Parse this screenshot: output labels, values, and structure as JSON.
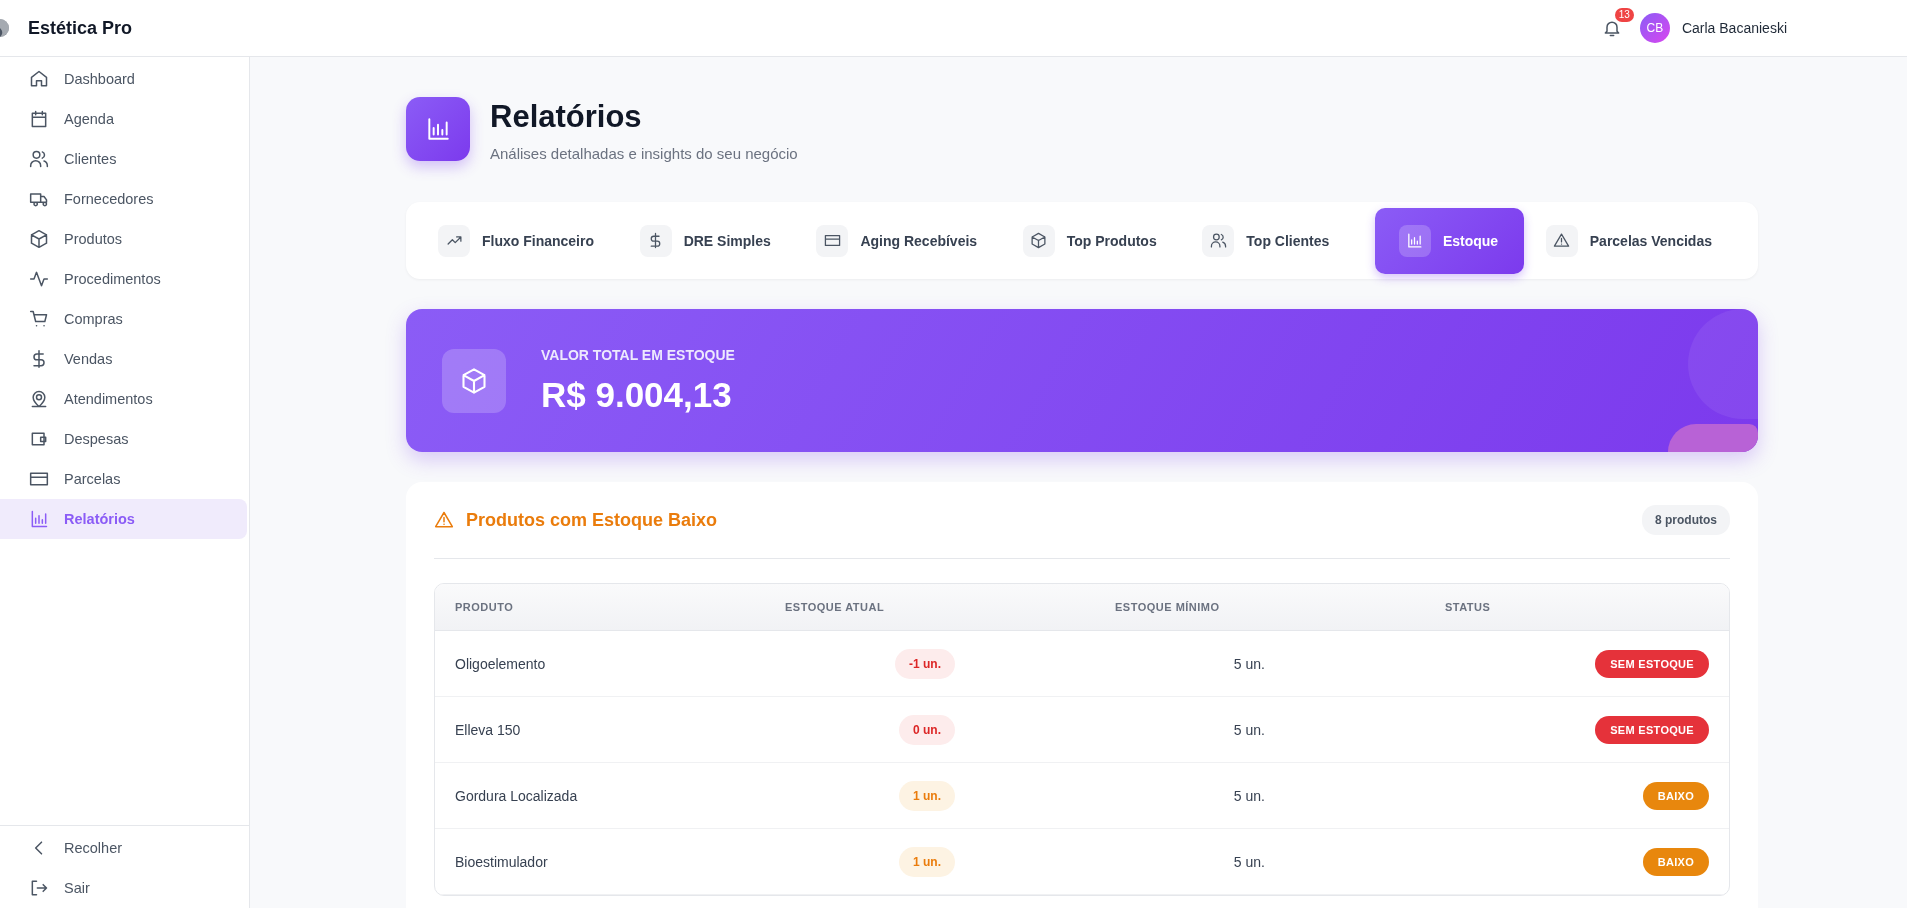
{
  "app": {
    "title": "Estética Pro"
  },
  "header": {
    "notification_count": "13",
    "user": {
      "initials": "CB",
      "name": "Carla Bacanieski"
    }
  },
  "sidebar": {
    "items": [
      {
        "label": "Dashboard",
        "selected": false
      },
      {
        "label": "Agenda",
        "selected": false
      },
      {
        "label": "Clientes",
        "selected": false
      },
      {
        "label": "Fornecedores",
        "selected": false
      },
      {
        "label": "Produtos",
        "selected": false
      },
      {
        "label": "Procedimentos",
        "selected": false
      },
      {
        "label": "Compras",
        "selected": false
      },
      {
        "label": "Vendas",
        "selected": false
      },
      {
        "label": "Atendimentos",
        "selected": false
      },
      {
        "label": "Despesas",
        "selected": false
      },
      {
        "label": "Parcelas",
        "selected": false
      },
      {
        "label": "Relatórios",
        "selected": true
      }
    ],
    "footer": [
      {
        "label": "Recolher"
      },
      {
        "label": "Sair"
      }
    ]
  },
  "page": {
    "title": "Relatórios",
    "subtitle": "Análises detalhadas e insights do seu negócio"
  },
  "tabs": [
    {
      "label": "Fluxo Financeiro",
      "selected": false
    },
    {
      "label": "DRE Simples",
      "selected": false
    },
    {
      "label": "Aging Recebíveis",
      "selected": false
    },
    {
      "label": "Top Produtos",
      "selected": false
    },
    {
      "label": "Top Clientes",
      "selected": false
    },
    {
      "label": "Estoque",
      "selected": true
    },
    {
      "label": "Parcelas Vencidas",
      "selected": false
    }
  ],
  "summary": {
    "label": "VALOR TOTAL EM ESTOQUE",
    "value": "R$ 9.004,13"
  },
  "low_stock": {
    "title": "Produtos com Estoque Baixo",
    "count": "8 produtos",
    "columns": [
      "PRODUTO",
      "ESTOQUE ATUAL",
      "ESTOQUE MÍNIMO",
      "STATUS"
    ],
    "rows": [
      {
        "product": "Oligoelemento",
        "current": "-1 un.",
        "minimum": "5 un.",
        "status": "SEM ESTOQUE",
        "kind": "out"
      },
      {
        "product": "Elleva 150",
        "current": "0 un.",
        "minimum": "5 un.",
        "status": "SEM ESTOQUE",
        "kind": "out"
      },
      {
        "product": "Gordura Localizada",
        "current": "1 un.",
        "minimum": "5 un.",
        "status": "BAIXO",
        "kind": "low"
      },
      {
        "product": "Bioestimulador",
        "current": "1 un.",
        "minimum": "5 un.",
        "status": "BAIXO",
        "kind": "low"
      }
    ]
  }
}
